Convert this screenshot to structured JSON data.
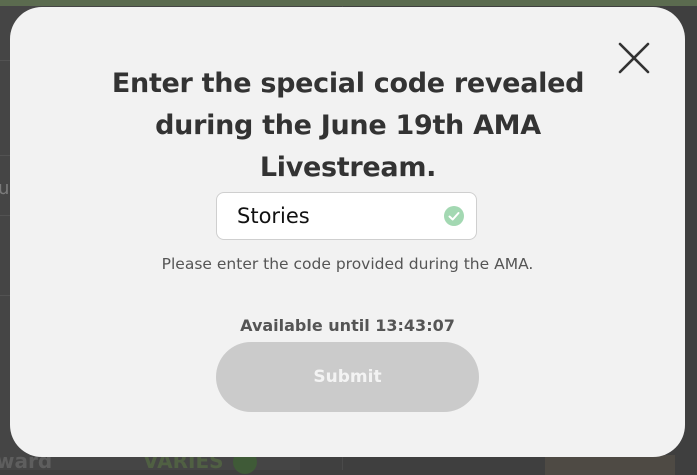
{
  "background": {
    "left_text": "u",
    "reward_label": "ward",
    "reward_value": "VARIES"
  },
  "modal": {
    "title": "Enter the special code revealed during the June 19th AMA Livestream.",
    "code_input": {
      "value": "Stories",
      "status_icon": "check-circle-icon",
      "status_color": "#a3d8b2"
    },
    "help_text": "Please enter the code provided during the AMA.",
    "availability": "Available until 13:43:07",
    "submit_label": "Submit",
    "close_icon": "close-icon"
  }
}
